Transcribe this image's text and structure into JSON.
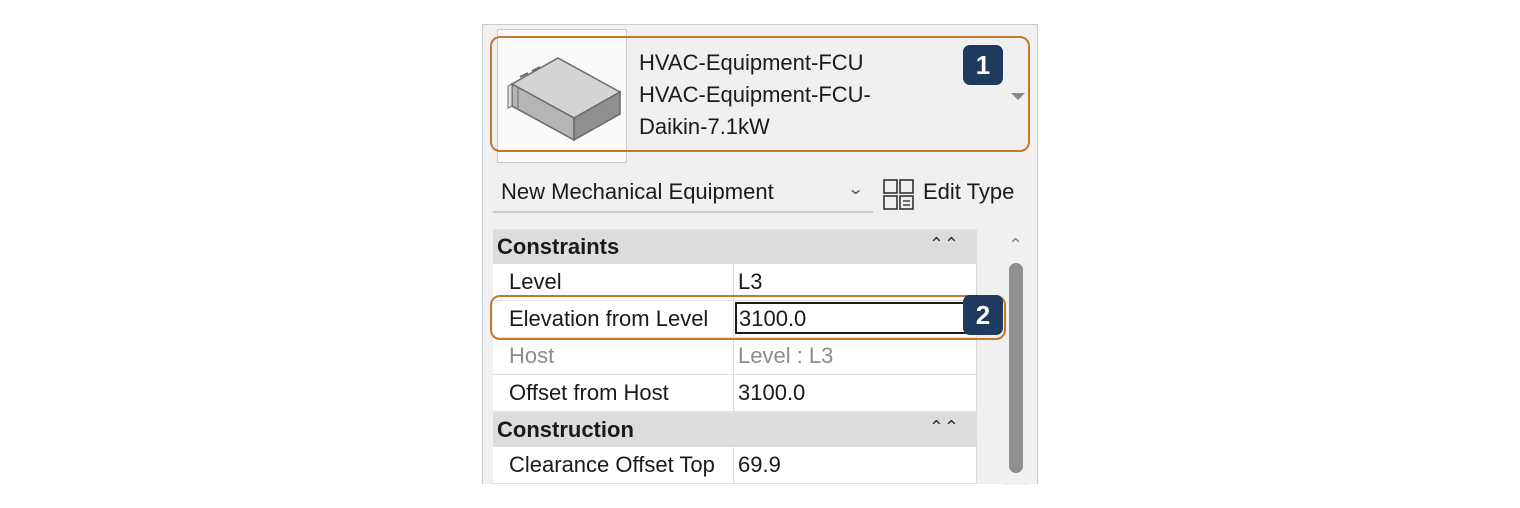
{
  "type_selector": {
    "line1": "HVAC-Equipment-FCU",
    "line2": "HVAC-Equipment-FCU-",
    "line3": "Daikin-7.1kW"
  },
  "instance": {
    "label": "New Mechanical Equipment",
    "edit_type_label": "Edit Type"
  },
  "groups": {
    "constraints": {
      "title": "Constraints",
      "rows": [
        {
          "name": "Level",
          "value": "L3"
        },
        {
          "name": "Elevation from Level",
          "value": "3100.0"
        },
        {
          "name": "Host",
          "value": "Level : L3"
        },
        {
          "name": "Offset from Host",
          "value": "3100.0"
        }
      ]
    },
    "construction": {
      "title": "Construction",
      "rows": [
        {
          "name": "Clearance Offset Top",
          "value": "69.9"
        }
      ]
    }
  },
  "callouts": {
    "badge1": "1",
    "badge2": "2"
  },
  "icons": {
    "collapse": "double-chevron-up-icon",
    "dropdown": "dropdown-arrow-icon",
    "edit_type": "edit-type-icon"
  },
  "colors": {
    "callout_border": "#c47a2c",
    "badge_bg": "#1e3a5f"
  }
}
